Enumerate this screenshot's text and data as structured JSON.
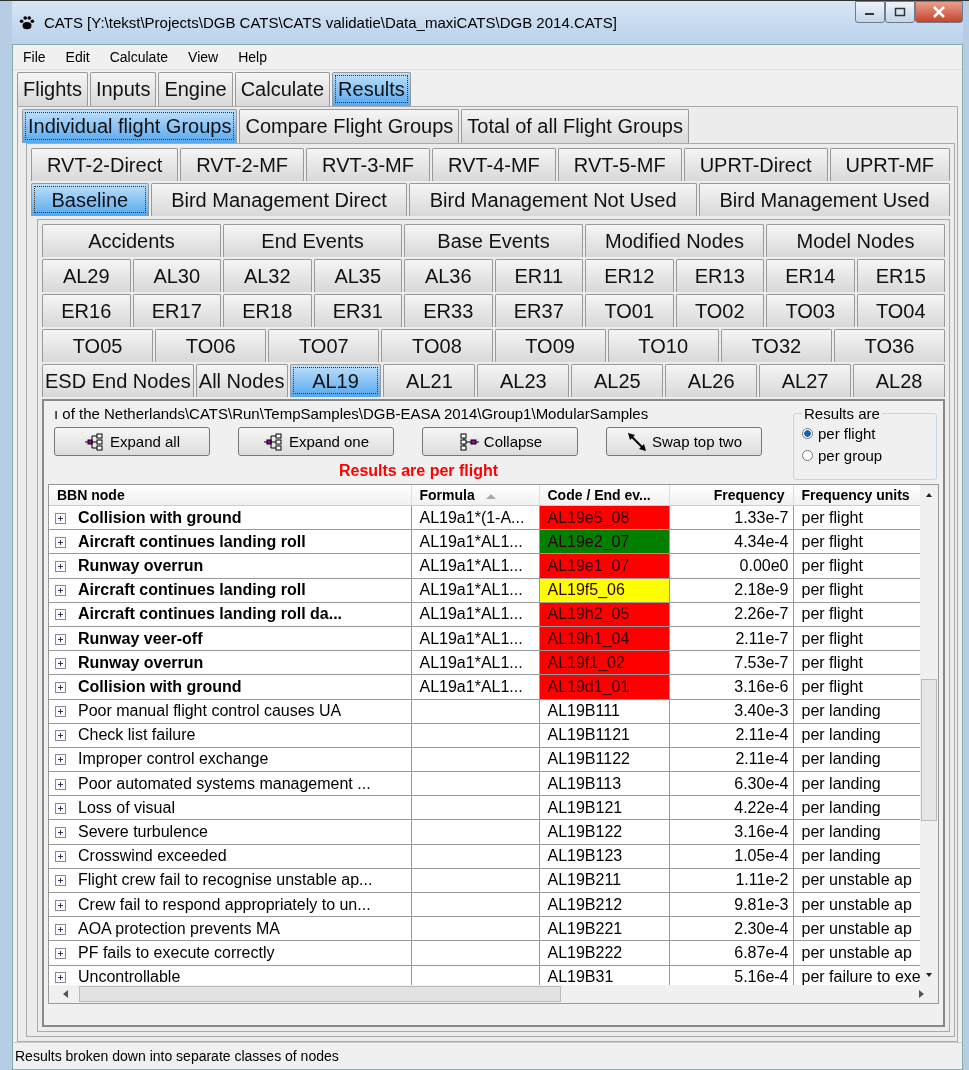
{
  "window": {
    "title": "CATS [Y:\\tekst\\Projects\\DGB CATS\\CATS validatie\\Data_maxiCATS\\DGB 2014.CATS]"
  },
  "menu": [
    "File",
    "Edit",
    "Calculate",
    "View",
    "Help"
  ],
  "main_tabs": [
    {
      "label": "Flights",
      "selected": false
    },
    {
      "label": "Inputs",
      "selected": false
    },
    {
      "label": "Engine",
      "selected": false
    },
    {
      "label": "Calculate",
      "selected": false
    },
    {
      "label": "Results",
      "selected": true
    }
  ],
  "group_tabs": [
    {
      "label": "Individual flight Groups",
      "selected": true
    },
    {
      "label": "Compare Flight Groups",
      "selected": false
    },
    {
      "label": "Total of all Flight Groups",
      "selected": false
    }
  ],
  "scenario_tabs": [
    [
      {
        "label": "RVT-2-Direct",
        "selected": false
      },
      {
        "label": "RVT-2-MF",
        "selected": false
      },
      {
        "label": "RVT-3-MF",
        "selected": false
      },
      {
        "label": "RVT-4-MF",
        "selected": false
      },
      {
        "label": "RVT-5-MF",
        "selected": false
      },
      {
        "label": "UPRT-Direct",
        "selected": false
      },
      {
        "label": "UPRT-MF",
        "selected": false
      }
    ],
    [
      {
        "label": "Baseline",
        "selected": true
      },
      {
        "label": "Bird Management Direct",
        "selected": false
      },
      {
        "label": "Bird Management Not Used",
        "selected": false
      },
      {
        "label": "Bird Management Used",
        "selected": false
      }
    ]
  ],
  "node_tabs": [
    [
      {
        "label": "Accidents",
        "selected": false
      },
      {
        "label": "End Events",
        "selected": false
      },
      {
        "label": "Base Events",
        "selected": false
      },
      {
        "label": "Modified Nodes",
        "selected": false
      },
      {
        "label": "Model Nodes",
        "selected": false
      }
    ],
    [
      {
        "label": "AL29",
        "selected": false
      },
      {
        "label": "AL30",
        "selected": false
      },
      {
        "label": "AL32",
        "selected": false
      },
      {
        "label": "AL35",
        "selected": false
      },
      {
        "label": "AL36",
        "selected": false
      },
      {
        "label": "ER11",
        "selected": false
      },
      {
        "label": "ER12",
        "selected": false
      },
      {
        "label": "ER13",
        "selected": false
      },
      {
        "label": "ER14",
        "selected": false
      },
      {
        "label": "ER15",
        "selected": false
      }
    ],
    [
      {
        "label": "ER16",
        "selected": false
      },
      {
        "label": "ER17",
        "selected": false
      },
      {
        "label": "ER18",
        "selected": false
      },
      {
        "label": "ER31",
        "selected": false
      },
      {
        "label": "ER33",
        "selected": false
      },
      {
        "label": "ER37",
        "selected": false
      },
      {
        "label": "TO01",
        "selected": false
      },
      {
        "label": "TO02",
        "selected": false
      },
      {
        "label": "TO03",
        "selected": false
      },
      {
        "label": "TO04",
        "selected": false
      }
    ],
    [
      {
        "label": "TO05",
        "selected": false
      },
      {
        "label": "TO06",
        "selected": false
      },
      {
        "label": "TO07",
        "selected": false
      },
      {
        "label": "TO08",
        "selected": false
      },
      {
        "label": "TO09",
        "selected": false
      },
      {
        "label": "TO10",
        "selected": false
      },
      {
        "label": "TO32",
        "selected": false
      },
      {
        "label": "TO36",
        "selected": false
      }
    ],
    [
      {
        "label": "ESD End Nodes",
        "selected": false
      },
      {
        "label": "All Nodes",
        "selected": false
      },
      {
        "label": "AL19",
        "selected": true
      },
      {
        "label": "AL21",
        "selected": false
      },
      {
        "label": "AL23",
        "selected": false
      },
      {
        "label": "AL25",
        "selected": false
      },
      {
        "label": "AL26",
        "selected": false
      },
      {
        "label": "AL27",
        "selected": false
      },
      {
        "label": "AL28",
        "selected": false
      }
    ]
  ],
  "path": "ı of the Netherlands\\CATS\\Run\\TempSamples\\DGB-EASA 2014\\Group1\\ModularSamples",
  "buttons": [
    {
      "label": "Expand all",
      "kind": "expand"
    },
    {
      "label": "Expand one",
      "kind": "expand"
    },
    {
      "label": "Collapse",
      "kind": "collapse"
    },
    {
      "label": "Swap top two",
      "kind": "swap"
    }
  ],
  "results_mode": {
    "title": "Results are",
    "options": [
      {
        "label": "per flight",
        "selected": true
      },
      {
        "label": "per group",
        "selected": false
      }
    ]
  },
  "notice": "Results are per flight",
  "table": {
    "columns": [
      "BBN node",
      "Formula",
      "Code / End ev...",
      "Frequency",
      "Frequency units"
    ],
    "rows": [
      {
        "kind": "end_event",
        "node": "Collision with ground",
        "formula": "AL19a1*(1-A...",
        "code": "AL19e5_08",
        "color": "#ff0000",
        "frequency": "1.33e-7",
        "units": "per flight"
      },
      {
        "kind": "end_event",
        "node": "Aircraft continues landing roll",
        "formula": "AL19a1*AL1...",
        "code": "AL19e2_07",
        "color": "#007f00",
        "frequency": "4.34e-4",
        "units": "per flight"
      },
      {
        "kind": "end_event",
        "node": "Runway overrun",
        "formula": "AL19a1*AL1...",
        "code": "AL19e1_07",
        "color": "#ff0000",
        "frequency": "0.00e0",
        "units": "per flight"
      },
      {
        "kind": "end_event",
        "node": "Aircraft continues landing roll",
        "formula": "AL19a1*AL1...",
        "code": "AL19f5_06",
        "color": "#ffff00",
        "frequency": "2.18e-9",
        "units": "per flight"
      },
      {
        "kind": "end_event",
        "node": "Aircraft continues landing roll da...",
        "formula": "AL19a1*AL1...",
        "code": "AL19h2_05",
        "color": "#ff0000",
        "frequency": "2.26e-7",
        "units": "per flight"
      },
      {
        "kind": "end_event",
        "node": "Runway veer-off",
        "formula": "AL19a1*AL1...",
        "code": "AL19h1_04",
        "color": "#ff0000",
        "frequency": "2.11e-7",
        "units": "per flight"
      },
      {
        "kind": "end_event",
        "node": "Runway overrun",
        "formula": "AL19a1*AL1...",
        "code": "AL19f1_02",
        "color": "#ff0000",
        "frequency": "7.53e-7",
        "units": "per flight"
      },
      {
        "kind": "end_event",
        "node": "Collision with ground",
        "formula": "AL19a1*AL1...",
        "code": "AL19d1_01",
        "color": "#ff0000",
        "frequency": "3.16e-6",
        "units": "per flight"
      },
      {
        "kind": "node",
        "node": "Poor manual flight control causes UA",
        "code": "AL19B111",
        "frequency": "3.40e-3",
        "units": "per landing"
      },
      {
        "kind": "node",
        "node": "Check list failure",
        "code": "AL19B1121",
        "frequency": "2.11e-4",
        "units": "per landing"
      },
      {
        "kind": "node",
        "node": "Improper control exchange",
        "code": "AL19B1122",
        "frequency": "2.11e-4",
        "units": "per landing"
      },
      {
        "kind": "node",
        "node": "Poor automated systems management ...",
        "code": "AL19B113",
        "frequency": "6.30e-4",
        "units": "per landing"
      },
      {
        "kind": "node",
        "node": "Loss of visual",
        "code": "AL19B121",
        "frequency": "4.22e-4",
        "units": "per landing"
      },
      {
        "kind": "node",
        "node": "Severe turbulence",
        "code": "AL19B122",
        "frequency": "3.16e-4",
        "units": "per landing"
      },
      {
        "kind": "node",
        "node": "Crosswind exceeded",
        "code": "AL19B123",
        "frequency": "1.05e-4",
        "units": "per landing"
      },
      {
        "kind": "node",
        "node": "Flight crew fail to recognise unstable ap...",
        "code": "AL19B211",
        "frequency": "1.11e-2",
        "units": "per unstable ap"
      },
      {
        "kind": "node",
        "node": "Crew fail to respond appropriately to un...",
        "code": "AL19B212",
        "frequency": "9.81e-3",
        "units": "per unstable ap"
      },
      {
        "kind": "node",
        "node": "AOA protection prevents MA",
        "code": "AL19B221",
        "frequency": "2.30e-4",
        "units": "per unstable ap"
      },
      {
        "kind": "node",
        "node": "PF fails to execute correctly",
        "code": "AL19B222",
        "frequency": "6.87e-4",
        "units": "per unstable ap"
      },
      {
        "kind": "node",
        "node": "Uncontrollable",
        "code": "AL19B31",
        "frequency": "5.16e-4",
        "units": "per failure to exe"
      }
    ]
  },
  "status_bar": "Results broken down into separate classes of nodes"
}
